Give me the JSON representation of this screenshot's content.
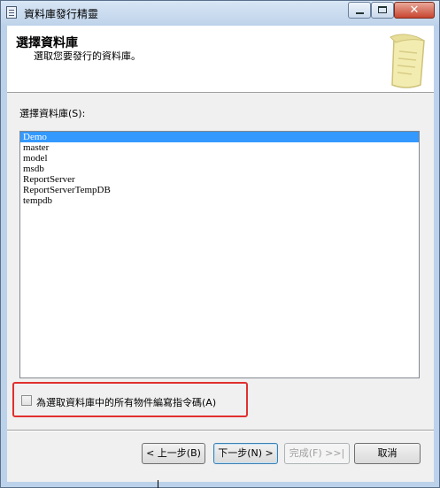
{
  "window": {
    "title": "資料庫發行精靈"
  },
  "header": {
    "title": "選擇資料庫",
    "subtitle": "選取您要發行的資料庫。"
  },
  "database_list": {
    "label": "選擇資料庫(S):",
    "items": [
      "Demo",
      "master",
      "model",
      "msdb",
      "ReportServer",
      "ReportServerTempDB",
      "tempdb"
    ],
    "selected": "Demo"
  },
  "script_all_checkbox": {
    "label": "為選取資料庫中的所有物件編寫指令碼(A)",
    "checked": false
  },
  "buttons": {
    "back": "< 上一步(B)",
    "next": "下一步(N) >",
    "finish": "完成(F) >>|",
    "cancel": "取消"
  },
  "colors": {
    "selection": "#3399ff",
    "highlight_box": "#e0302e",
    "title_bar": "#bfd3ea"
  }
}
